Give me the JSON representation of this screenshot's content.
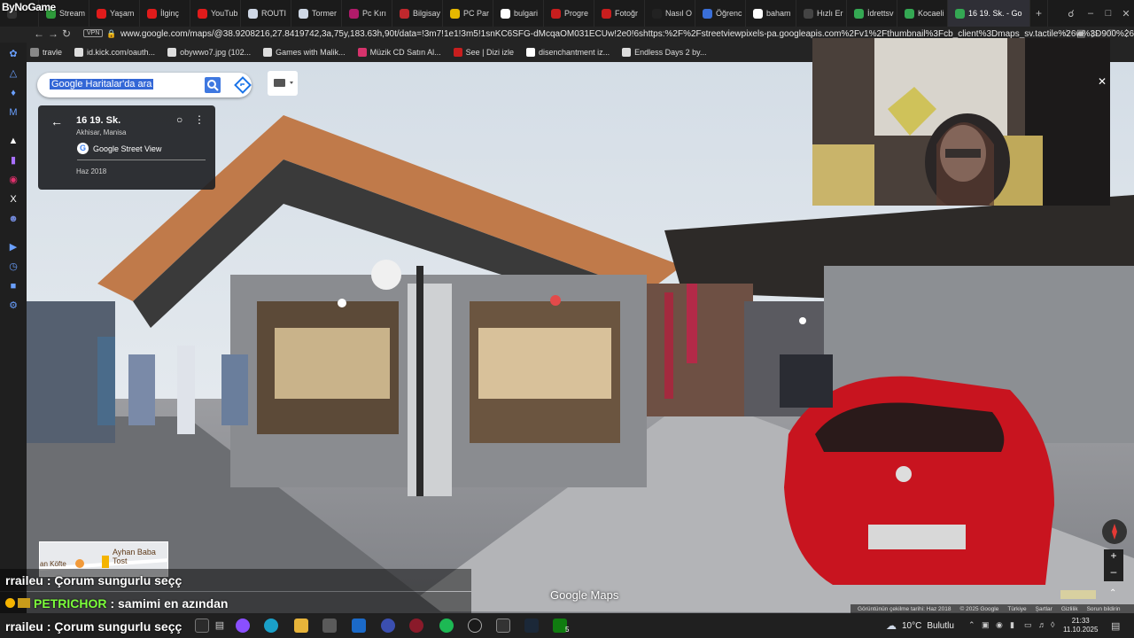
{
  "overlay": {
    "brand": "ByNoGame"
  },
  "tabs": [
    {
      "label": "Stream",
      "color": "#2e9a3a"
    },
    {
      "label": "Yaşam",
      "color": "#e01b1b"
    },
    {
      "label": "İlginç",
      "color": "#e01b1b"
    },
    {
      "label": "YouTub",
      "color": "#e01b1b"
    },
    {
      "label": "ROUTI",
      "color": "#cfd8e6"
    },
    {
      "label": "Tormer",
      "color": "#cfd8e6"
    },
    {
      "label": "Pc Kırı",
      "color": "#b01b6a"
    },
    {
      "label": "Bilgisay",
      "color": "#c0282d"
    },
    {
      "label": "PC Par",
      "color": "#e6b800"
    },
    {
      "label": "bulgari",
      "color": "#ffffff"
    },
    {
      "label": "Progre",
      "color": "#c81e1e"
    },
    {
      "label": "Fotoğr",
      "color": "#c81e1e"
    },
    {
      "label": "Nasıl O",
      "color": "#222222"
    },
    {
      "label": "Öğrenc",
      "color": "#3a6fd8"
    },
    {
      "label": "baham",
      "color": "#ffffff"
    },
    {
      "label": "Hızlı Er",
      "color": "#444444"
    },
    {
      "label": "İdrettsv",
      "color": "#34a853"
    },
    {
      "label": "Kocaeli",
      "color": "#34a853"
    },
    {
      "label": "16 19. Sk. - Go",
      "color": "#34a853",
      "active": true
    }
  ],
  "address_bar": {
    "vpn": "VPN",
    "url": "www.google.com/maps/@38.9208216,27.8419742,3a,75y,183.63h,90t/data=!3m7!1e1!3m5!1snKC6SFG-dMcqaOM031ECUw!2e0!6shttps:%2F%2Fstreetviewpixels-pa.googleapis.com%2Fv1%2Fthumbnail%3Fcb_client%3Dmaps_sv.tactile%26w%3D900%26"
  },
  "bookmarks": [
    {
      "label": "travle",
      "color": "#888888"
    },
    {
      "label": "id.kick.com/oauth...",
      "color": "#dddddd"
    },
    {
      "label": "obywwo7.jpg (102...",
      "color": "#dddddd"
    },
    {
      "label": "Games with Malik...",
      "color": "#dddddd"
    },
    {
      "label": "Müzik CD Satın Al...",
      "color": "#d6336c"
    },
    {
      "label": "See | Dizi izle",
      "color": "#c81e1e"
    },
    {
      "label": "disenchantment iz...",
      "color": "#ffffff"
    },
    {
      "label": "Endless Days 2 by...",
      "color": "#dddddd"
    }
  ],
  "maps": {
    "search_placeholder": "Google Haritalar'da ara",
    "place": {
      "title": "16 19. Sk.",
      "subtitle": "Akhisar, Manisa",
      "source": "Google Street View",
      "date": "Haz 2018"
    },
    "minimap": {
      "label1": "Ayhan Baba Tost",
      "label2": "an Köfte"
    },
    "logo": "Google Maps",
    "footer": [
      "Görüntünün çekilme tarihi: Haz 2018",
      "© 2025 Google",
      "Türkiye",
      "Şartlar",
      "Gizlilik",
      "Sorun bildirin"
    ]
  },
  "chat": [
    {
      "user": "rraileu",
      "text": ": Çorum sungurlu seçç",
      "user_color": "#ffffff"
    },
    {
      "user": "PETRICHOR",
      "text": ": samimi en azından",
      "user_color": "#7cff3b"
    },
    {
      "user": "rraileu",
      "text": ": Çorum sungurlu seçç",
      "user_color": "#ffffff"
    }
  ],
  "taskbar": {
    "weather": {
      "temp": "10°C",
      "desc": "Bulutlu"
    },
    "time": "21:33",
    "date": "11.10.2025",
    "badge": "5"
  }
}
